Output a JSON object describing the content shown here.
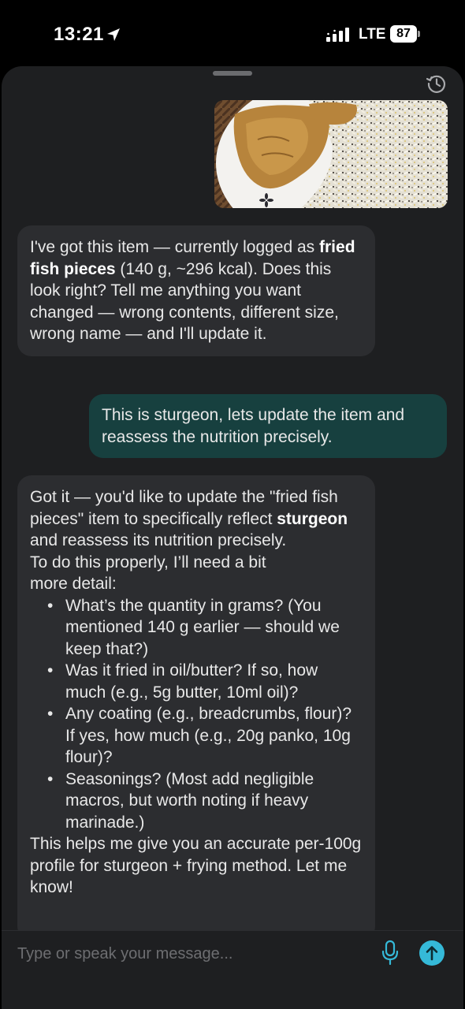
{
  "status_bar": {
    "time": "13:21",
    "network": "LTE",
    "battery": "87"
  },
  "chat": {
    "image_alt": "Plate of fried fish pieces with rice",
    "ai_message_1": {
      "parts": {
        "p1": "I've got this item — currently logged as ",
        "bold": "fried fish pieces",
        "p2": " (140 g, ~296 kcal). Does this look right? Tell me anything you want changed — wrong contents, different size, wrong name — and I'll update it."
      }
    },
    "user_message": "This is sturgeon, lets update the item and reassess the nutrition precisely.",
    "ai_message_2": {
      "intro_1": "Got it — you'd like to update the \"fried fish pieces\" item to specifically reflect ",
      "intro_bold": "sturgeon",
      "intro_2": " and reassess its nutrition precisely.",
      "lead": "To do this properly, I’ll need a bit more detail:",
      "bullets": [
        "What’s the quantity in grams? (You mentioned 140 g earlier — should we keep that?)",
        "Was it fried in oil/butter? If so, how much (e.g., 5g butter, 10ml oil)?",
        "Any coating (e.g., breadcrumbs, flour)? If yes, how much (e.g., 20g panko, 10g flour)?",
        "Seasonings? (Most add negligible macros, but worth noting if heavy marinade.)"
      ],
      "closing": "This helps me give you an accurate per-100g profile for sturgeon + frying method. Let me know!"
    }
  },
  "composer": {
    "placeholder": "Type or speak your message..."
  },
  "icons": {
    "location": "location-arrow-icon",
    "signal": "signal-bars-icon",
    "history": "history-icon",
    "mic": "microphone-icon",
    "send": "send-arrow-icon"
  },
  "colors": {
    "sheet": "#1e1f21",
    "ai_bubble": "#2c2d30",
    "user_bubble": "#17403f",
    "accent": "#35b9d8"
  }
}
